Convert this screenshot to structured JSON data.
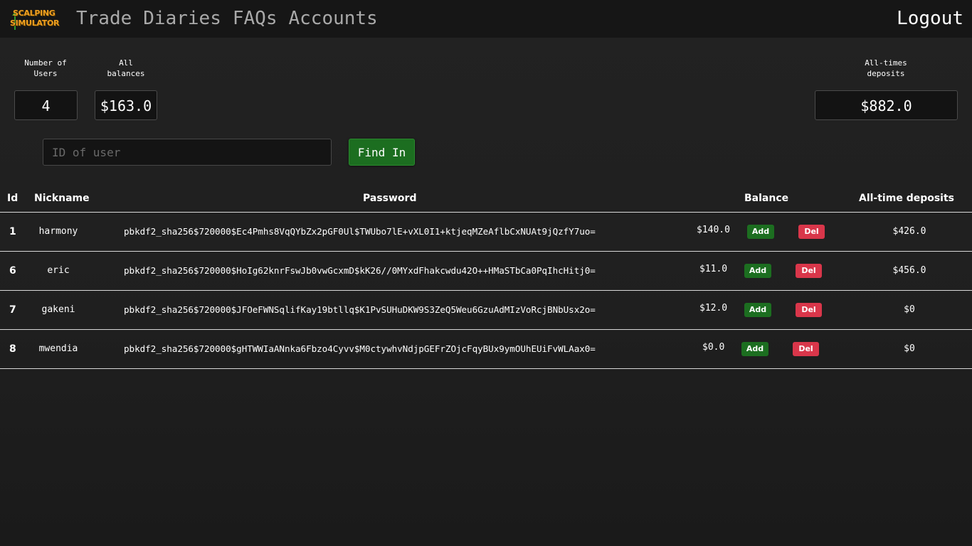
{
  "nav": {
    "logo_line1": "SCALPING",
    "logo_line2": "SIMULATOR",
    "links": [
      "Trade",
      "Diaries",
      "FAQs",
      "Accounts"
    ],
    "logout": "Logout"
  },
  "stats": {
    "users_label_1": "Number of",
    "users_label_2": "Users",
    "users_value": "4",
    "balances_label_1": "All",
    "balances_label_2": "balances",
    "balances_value": "$163.0",
    "deposits_label_1": "All-times",
    "deposits_label_2": "deposits",
    "deposits_value": "$882.0"
  },
  "search": {
    "placeholder": "ID of user",
    "button": "Find In"
  },
  "table": {
    "headers": [
      "Id",
      "Nickname",
      "Password",
      "Balance",
      "All-time deposits"
    ],
    "add_label": "Add",
    "del_label": "Del",
    "rows": [
      {
        "id": "1",
        "nickname": "harmony",
        "password": "pbkdf2_sha256$720000$Ec4Pmhs8VqQYbZx2pGF0Ul$TWUbo7lE+vXL0I1+ktjeqMZeAflbCxNUAt9jQzfY7uo=",
        "balance": "$140.0",
        "deposits": "$426.0"
      },
      {
        "id": "6",
        "nickname": "eric",
        "password": "pbkdf2_sha256$720000$HoIg62knrFswJb0vwGcxmD$kK26//0MYxdFhakcwdu42O++HMaSTbCa0PqIhcHitj0=",
        "balance": "$11.0",
        "deposits": "$456.0"
      },
      {
        "id": "7",
        "nickname": "gakeni",
        "password": "pbkdf2_sha256$720000$JFOeFWNSqlifKay19btllq$K1PvSUHuDKW9S3ZeQ5Weu6GzuAdMIzVoRcjBNbUsx2o=",
        "balance": "$12.0",
        "deposits": "$0"
      },
      {
        "id": "8",
        "nickname": "mwendia",
        "password": "pbkdf2_sha256$720000$gHTWWIaANnka6Fbzo4Cyvv$M0ctywhvNdjpGEFrZOjcFqyBUx9ymOUhEUiFvWLAax0=",
        "balance": "$0.0",
        "deposits": "$0"
      }
    ]
  }
}
